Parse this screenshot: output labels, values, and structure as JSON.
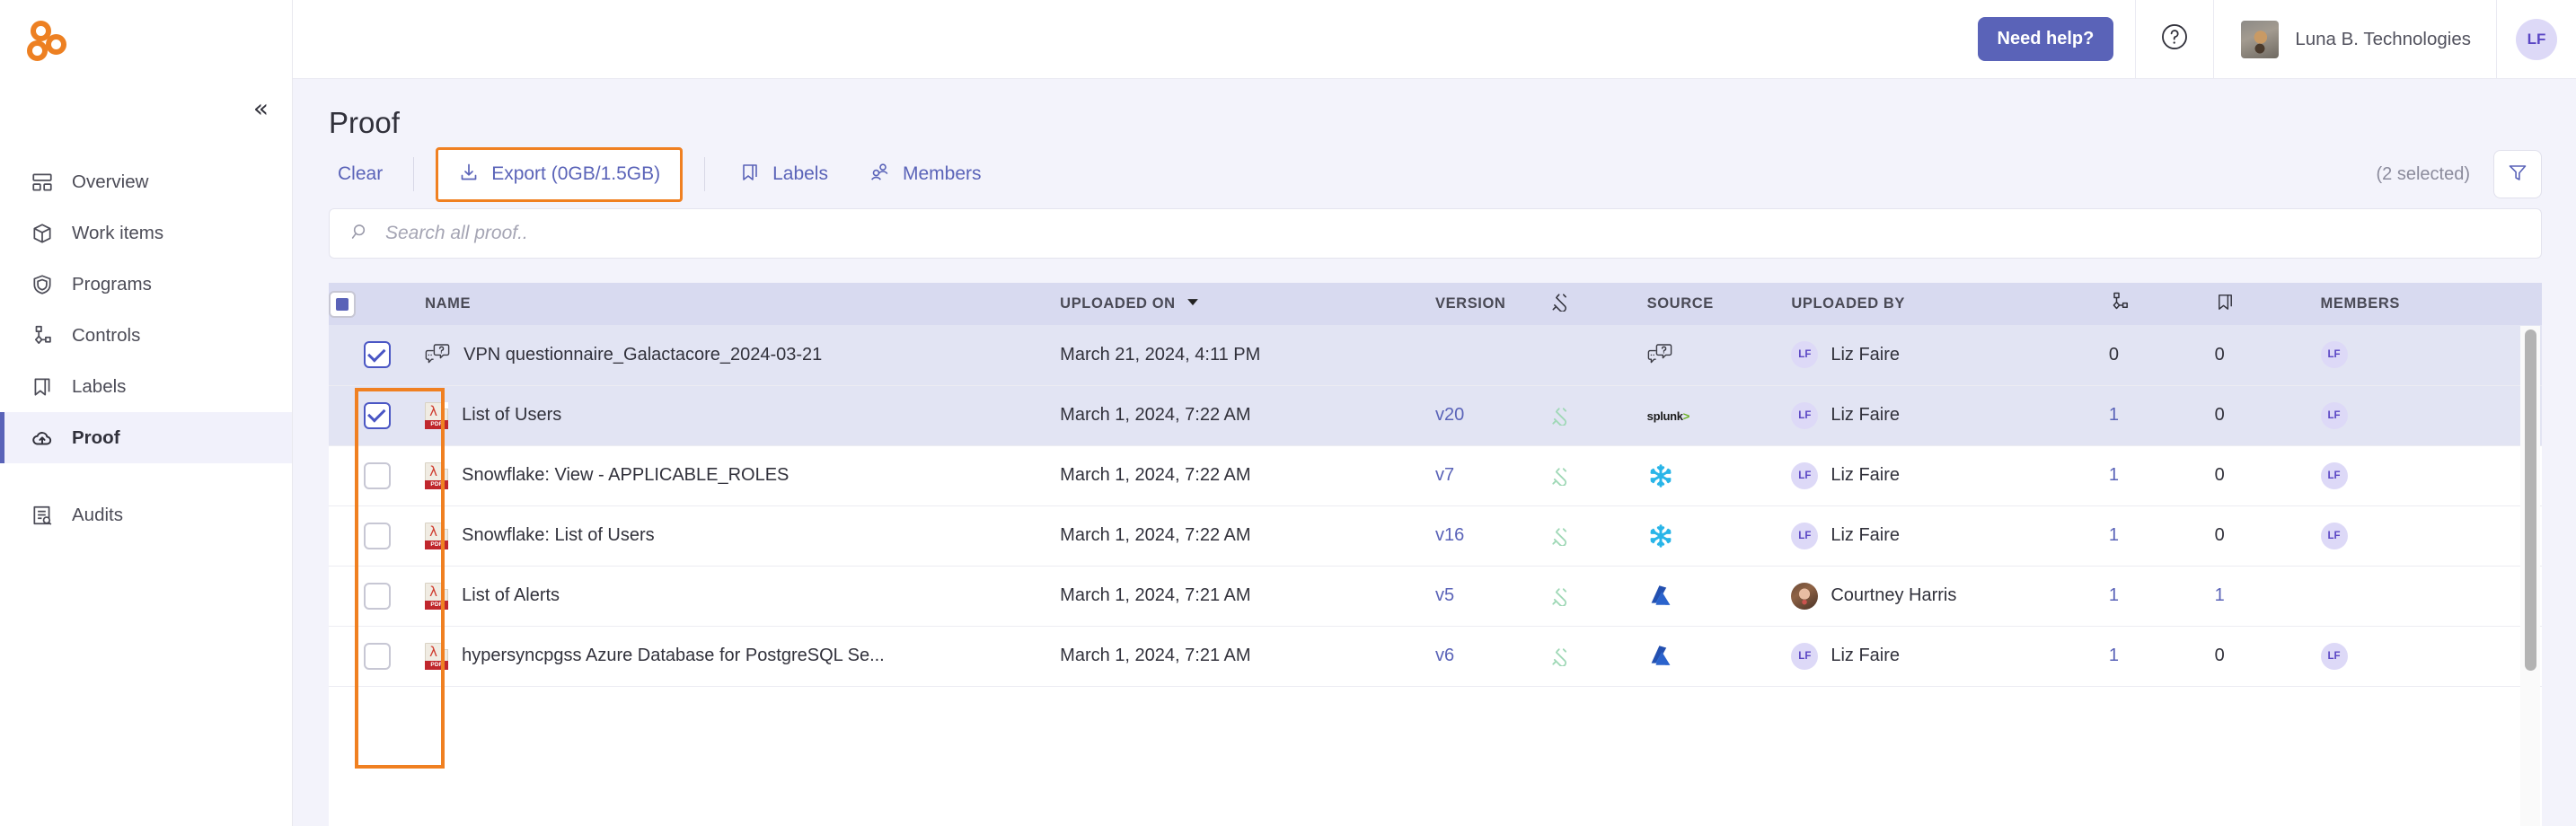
{
  "sidebar": {
    "logo_name": "app-logo",
    "collapse_icon": "chevron-double-left-icon",
    "items": [
      {
        "label": "Overview",
        "icon": "dashboard-icon",
        "active": false
      },
      {
        "label": "Work items",
        "icon": "box-icon",
        "active": false
      },
      {
        "label": "Programs",
        "icon": "shield-icon",
        "active": false
      },
      {
        "label": "Controls",
        "icon": "controls-icon",
        "active": false
      },
      {
        "label": "Labels",
        "icon": "bookmark-icon",
        "active": false
      },
      {
        "label": "Proof",
        "icon": "cloud-upload-icon",
        "active": true
      },
      {
        "label": "Audits",
        "icon": "audit-icon",
        "active": false
      }
    ]
  },
  "topbar": {
    "need_help_label": "Need help?",
    "help_icon": "question-circle-icon",
    "org_name": "Luna B. Technologies",
    "org_avatar": "org-avatar-dog-photo",
    "user_initials": "LF"
  },
  "page": {
    "title": "Proof"
  },
  "toolbar": {
    "clear_label": "Clear",
    "export_label": "Export (0GB/1.5GB)",
    "export_icon": "download-icon",
    "labels_label": "Labels",
    "labels_icon": "bookmark-icon",
    "members_label": "Members",
    "members_icon": "people-icon",
    "selected_text": "(2 selected)",
    "filter_icon": "funnel-icon",
    "highlight_color": "#f08021"
  },
  "search": {
    "placeholder": "Search all proof..",
    "value": "",
    "icon": "search-icon"
  },
  "table": {
    "headers": {
      "name": "NAME",
      "uploaded_on": "UPLOADED ON",
      "sort_icon": "caret-down-icon",
      "version": "VERSION",
      "plug_icon": "plug-icon",
      "source": "SOURCE",
      "uploaded_by": "UPLOADED BY",
      "controls_icon": "controls-icon",
      "labels_icon": "bookmark-icon",
      "members": "MEMBERS"
    },
    "select_all_state": "indeterminate",
    "rows": [
      {
        "selected": true,
        "file_icon": "questionnaire-icon",
        "name": "VPN questionnaire_Galactacore_2024-03-21",
        "uploaded_on": "March 21, 2024, 4:11 PM",
        "version": "",
        "plug": false,
        "source": "questionnaire",
        "uploaded_by": "Liz Faire",
        "uploaded_by_avatar": "LF",
        "controls_count": "0",
        "controls_link": false,
        "labels_count": "0",
        "labels_link": false,
        "member_avatar": "LF"
      },
      {
        "selected": true,
        "file_icon": "pdf-icon",
        "name": "List of Users",
        "uploaded_on": "March 1, 2024, 7:22 AM",
        "version": "v20",
        "plug": true,
        "source": "splunk",
        "uploaded_by": "Liz Faire",
        "uploaded_by_avatar": "LF",
        "controls_count": "1",
        "controls_link": true,
        "labels_count": "0",
        "labels_link": false,
        "member_avatar": "LF"
      },
      {
        "selected": false,
        "file_icon": "pdf-icon",
        "name": "Snowflake: View - APPLICABLE_ROLES",
        "uploaded_on": "March 1, 2024, 7:22 AM",
        "version": "v7",
        "plug": true,
        "source": "snowflake",
        "uploaded_by": "Liz Faire",
        "uploaded_by_avatar": "LF",
        "controls_count": "1",
        "controls_link": true,
        "labels_count": "0",
        "labels_link": false,
        "member_avatar": "LF"
      },
      {
        "selected": false,
        "file_icon": "pdf-icon",
        "name": "Snowflake: List of Users",
        "uploaded_on": "March 1, 2024, 7:22 AM",
        "version": "v16",
        "plug": true,
        "source": "snowflake",
        "uploaded_by": "Liz Faire",
        "uploaded_by_avatar": "LF",
        "controls_count": "1",
        "controls_link": true,
        "labels_count": "0",
        "labels_link": false,
        "member_avatar": "LF"
      },
      {
        "selected": false,
        "file_icon": "pdf-icon",
        "name": "List of Alerts",
        "uploaded_on": "March 1, 2024, 7:21 AM",
        "version": "v5",
        "plug": true,
        "source": "azure",
        "uploaded_by": "Courtney Harris",
        "uploaded_by_avatar": "photo",
        "controls_count": "1",
        "controls_link": true,
        "labels_count": "1",
        "labels_link": true,
        "member_avatar": "photo"
      },
      {
        "selected": false,
        "file_icon": "pdf-icon",
        "name": "hypersyncpgss Azure Database for PostgreSQL Se...",
        "uploaded_on": "March 1, 2024, 7:21 AM",
        "version": "v6",
        "plug": true,
        "source": "azure",
        "uploaded_by": "Liz Faire",
        "uploaded_by_avatar": "LF",
        "controls_count": "1",
        "controls_link": true,
        "labels_count": "0",
        "labels_link": false,
        "member_avatar": "LF"
      }
    ]
  },
  "colors": {
    "brand_orange": "#ed8022",
    "accent_purple": "#5a63b8",
    "selected_row": "#e2e4f3",
    "header_row": "#d8daf0",
    "page_bg": "#f3f3fb"
  }
}
